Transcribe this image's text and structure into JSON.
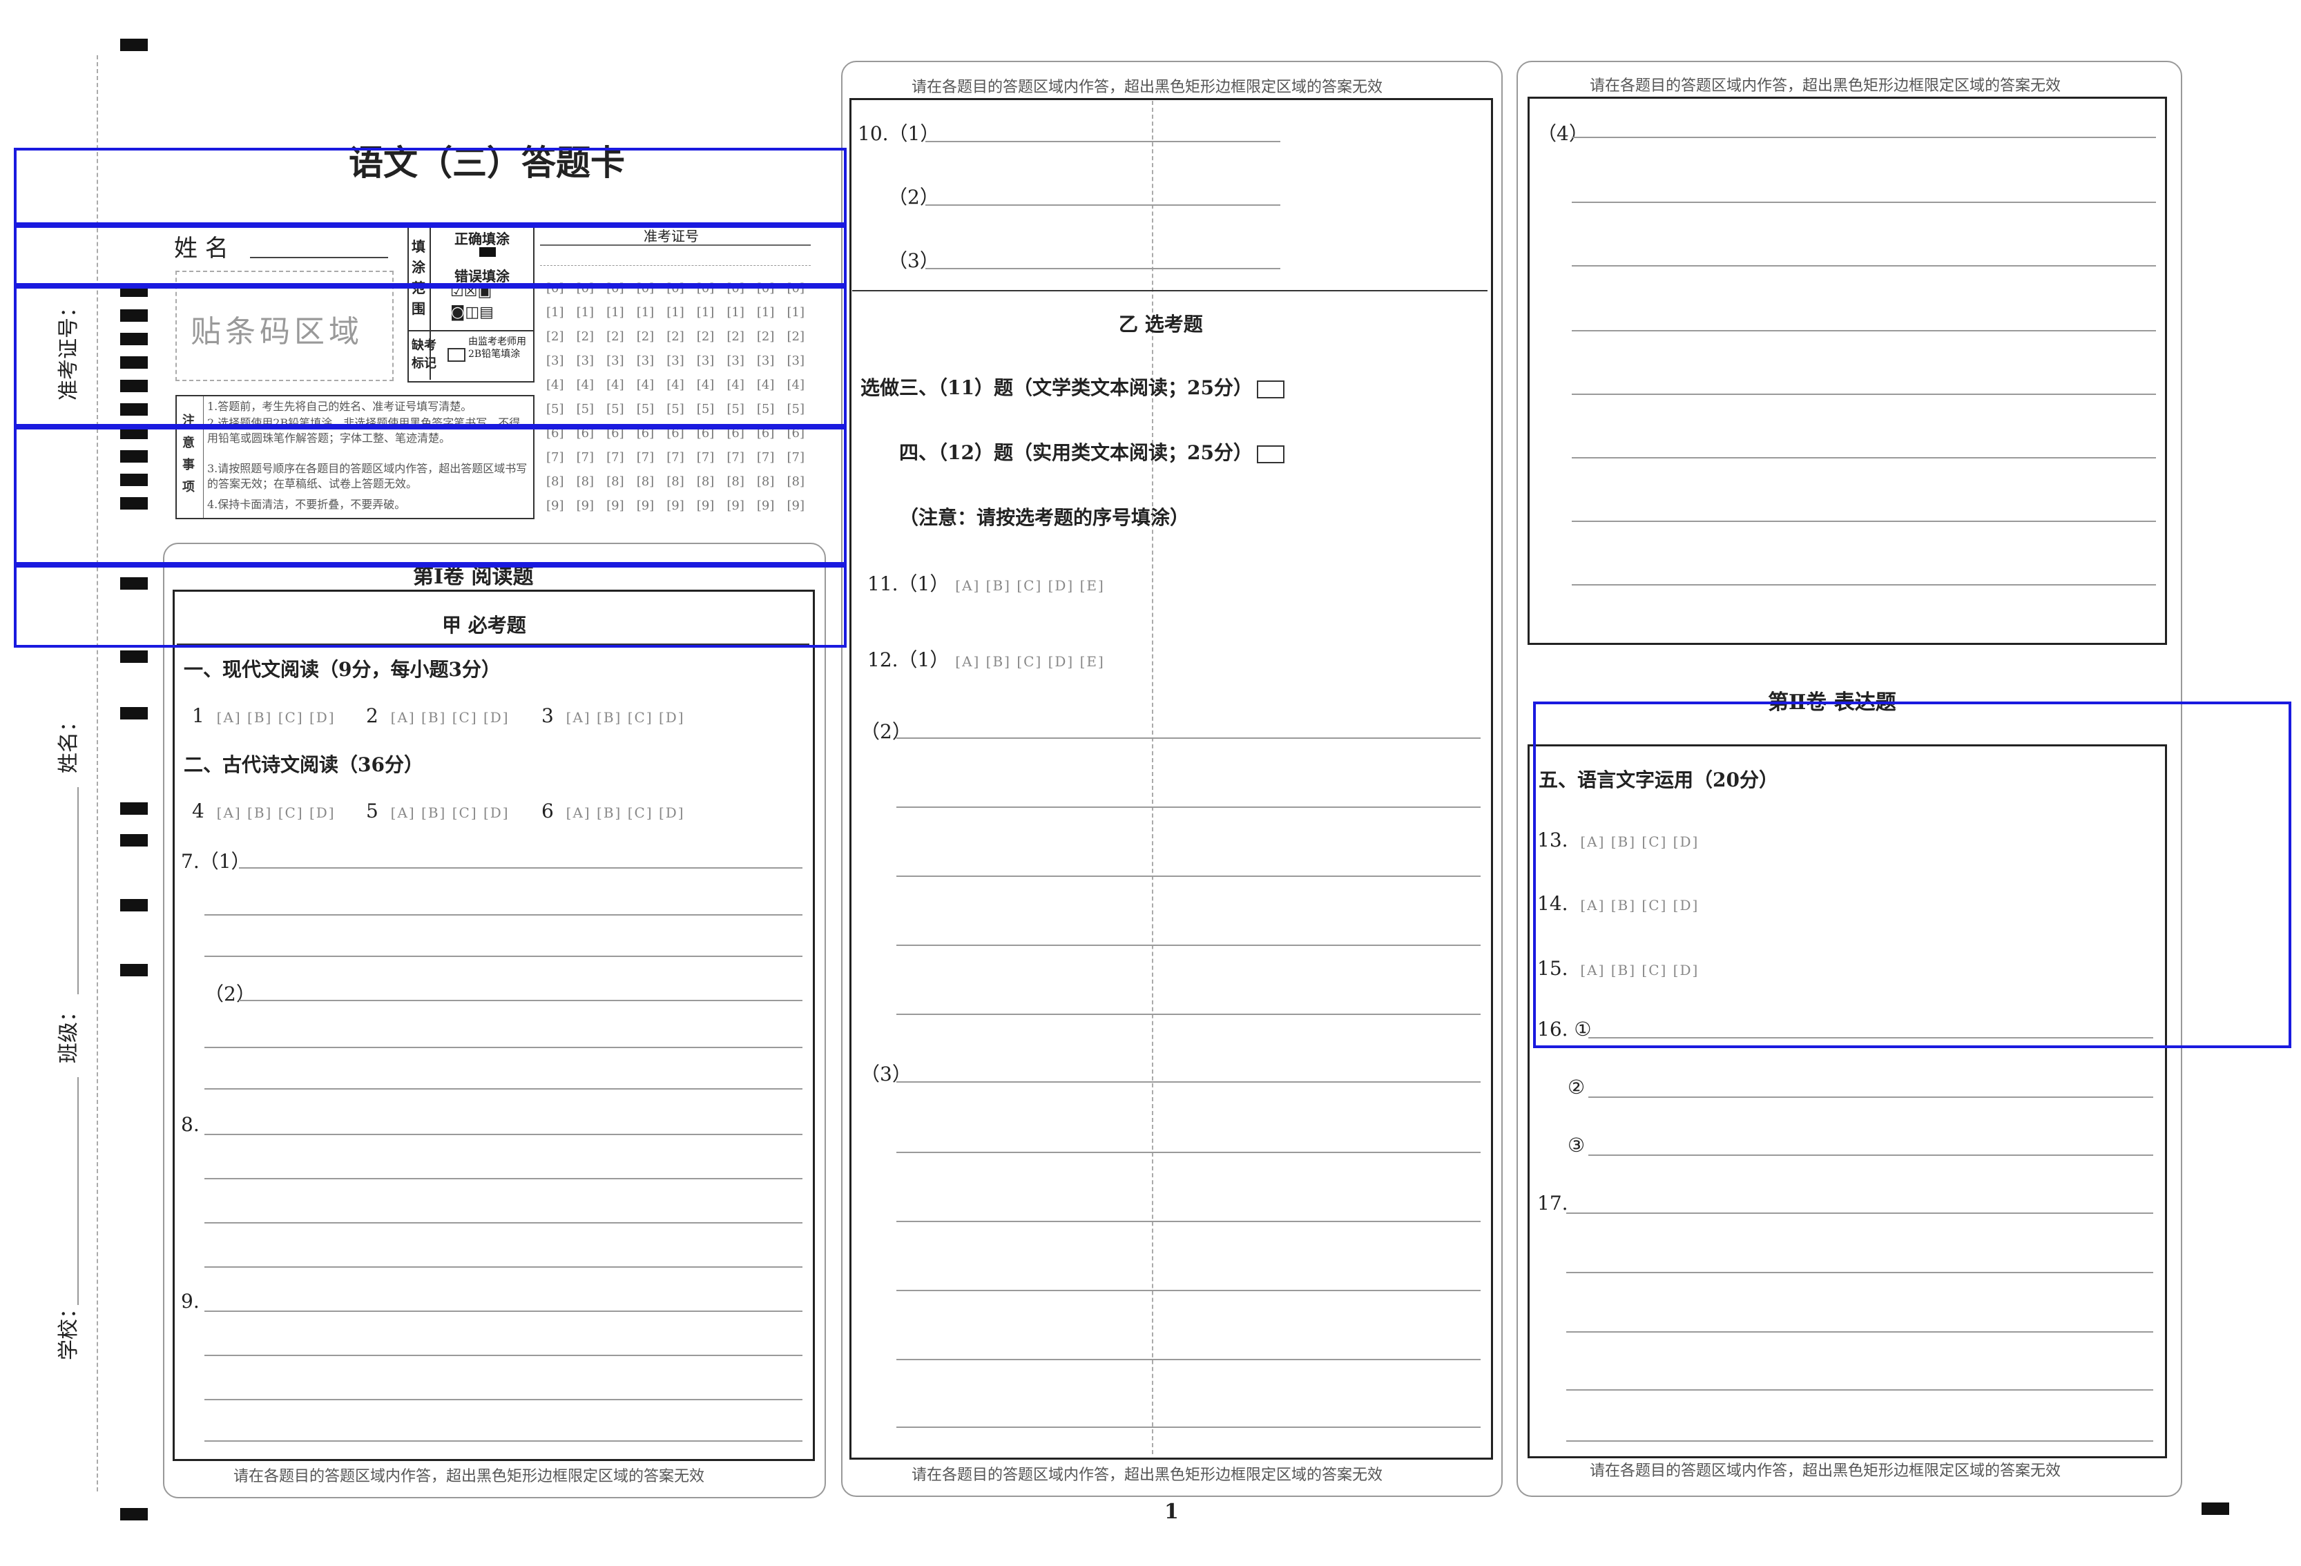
{
  "card_title": "语文（三）答题卡",
  "header": {
    "name_label": "姓  名",
    "barcode_area": "贴条码区域",
    "fill_area_label": "填涂范围",
    "correct_fill": "正确填涂",
    "wrong_fill": "错误填涂",
    "absent_label": "缺考标记",
    "absent_note": "由监考老师用2B铅笔填涂",
    "exam_id_label": "准考证号",
    "notice_label": "注意事项",
    "notice_items": [
      "1.答题前，考生先将自己的姓名、准考证号填写清楚。",
      "2.选择题使用2B铅笔填涂，非选择题使用黑色签字笔书写，不得用铅笔或圆珠笔作解答题；字体工整、笔迹清楚。",
      "3.请按照题号顺序在各题目的答题区域内作答，超出答题区域书写的答案无效；在草稿纸、试卷上答题无效。",
      "4.保持卡面清洁，不要折叠，不要弄破。"
    ],
    "digits": [
      "[0]",
      "[1]",
      "[2]",
      "[3]",
      "[4]",
      "[5]",
      "[6]",
      "[7]",
      "[8]",
      "[9]"
    ]
  },
  "margin_labels": {
    "exam_id": "准考证号：",
    "name": "姓名：",
    "class": "班级：",
    "school": "学校："
  },
  "footer_note": "请在各题目的答题区域内作答，超出黑色矩形边框限定区域的答案无效",
  "page_number": "1",
  "col1": {
    "volume_title": "第Ⅰ卷   阅读题",
    "section_title": "甲   必考题",
    "s1": "一、现代文阅读（9分，每小题3分）",
    "s2": "二、古代诗文阅读（36分）",
    "mc": [
      {
        "num": "1",
        "opts": "[A] [B] [C] [D]"
      },
      {
        "num": "2",
        "opts": "[A] [B] [C] [D]"
      },
      {
        "num": "3",
        "opts": "[A] [B] [C] [D]"
      },
      {
        "num": "4",
        "opts": "[A] [B] [C] [D]"
      },
      {
        "num": "5",
        "opts": "[A] [B] [C] [D]"
      },
      {
        "num": "6",
        "opts": "[A] [B] [C] [D]"
      }
    ],
    "q7_1": "7.（1）",
    "q7_2": "（2）",
    "q8": "8.",
    "q9": "9."
  },
  "col2": {
    "q10_1": "10.（1）",
    "q10_2": "（2）",
    "q10_3": "（3）",
    "section_title": "乙   选考题",
    "opt3": "选做三、（11）题（文学类文本阅读；25分）",
    "opt4": "四、（12）题（实用类文本阅读；25分）",
    "note": "（注意：请按选考题的序号填涂）",
    "q11": "11.（1）",
    "q11_opts": "[A] [B] [C] [D] [E]",
    "q12": "12.（1）",
    "q12_opts": "[A] [B] [C] [D] [E]",
    "q_2": "（2）",
    "q_3": "（3）"
  },
  "col3": {
    "q4": "（4）",
    "volume_title": "第Ⅱ卷   表达题",
    "s5": "五、语言文字运用（20分）",
    "q13": "13.",
    "q14": "14.",
    "q15": "15.",
    "mc_opts": "[A] [B] [C] [D]",
    "q16": "16. ①",
    "q16_2": "②",
    "q16_3": "③",
    "q17": "17."
  }
}
